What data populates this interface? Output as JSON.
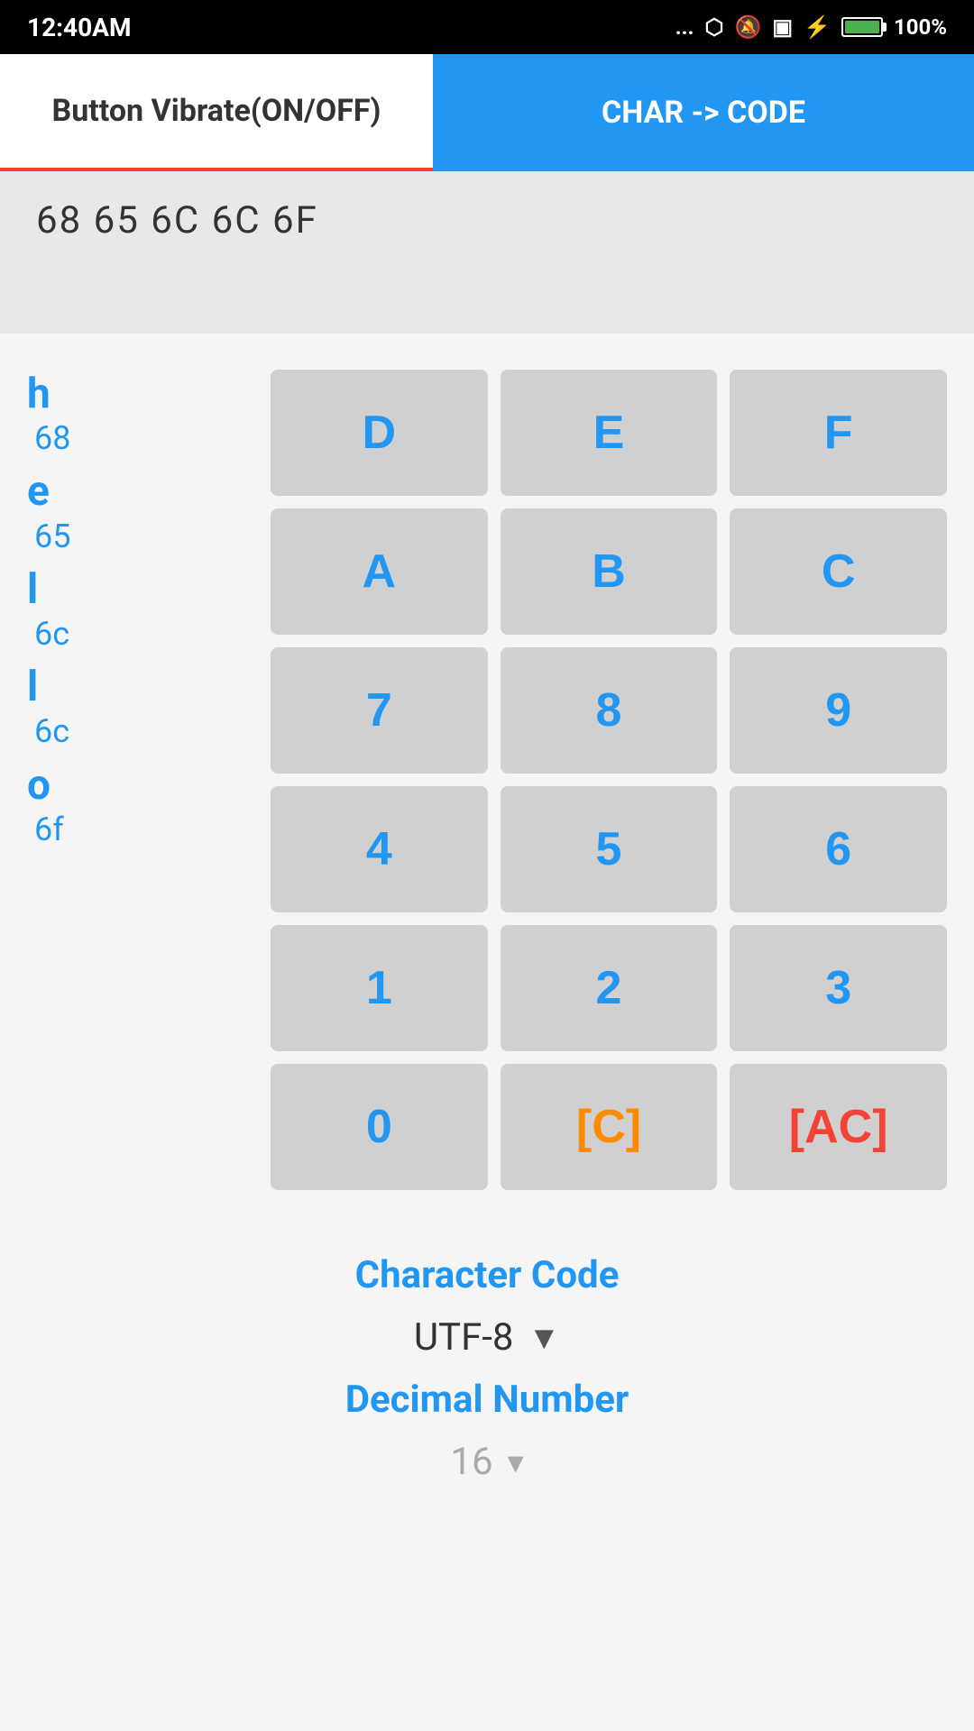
{
  "status_bar": {
    "time": "12:40AM",
    "dots": "...",
    "battery_percent": "100%"
  },
  "app_bar": {
    "tab1_label": "Button Vibrate(ON/OFF)",
    "tab2_label": "CHAR -> CODE"
  },
  "output": {
    "text": "68 65 6C 6C 6F"
  },
  "char_list": [
    {
      "letter": "h",
      "hex": "68"
    },
    {
      "letter": "e",
      "hex": "65"
    },
    {
      "letter": "l",
      "hex": "6c"
    },
    {
      "letter": "l",
      "hex": "6c"
    },
    {
      "letter": "o",
      "hex": "6f"
    }
  ],
  "keypad": {
    "rows": [
      [
        "D",
        "E",
        "F"
      ],
      [
        "A",
        "B",
        "C"
      ],
      [
        "7",
        "8",
        "9"
      ],
      [
        "4",
        "5",
        "6"
      ],
      [
        "1",
        "2",
        "3"
      ],
      [
        "0",
        "[C]",
        "[AC]"
      ]
    ]
  },
  "bottom": {
    "character_code_label": "Character Code",
    "encoding_value": "UTF-8",
    "encoding_arrow": "▼",
    "decimal_label": "Decimal Number",
    "decimal_value": "16",
    "decimal_arrow": "▾"
  }
}
